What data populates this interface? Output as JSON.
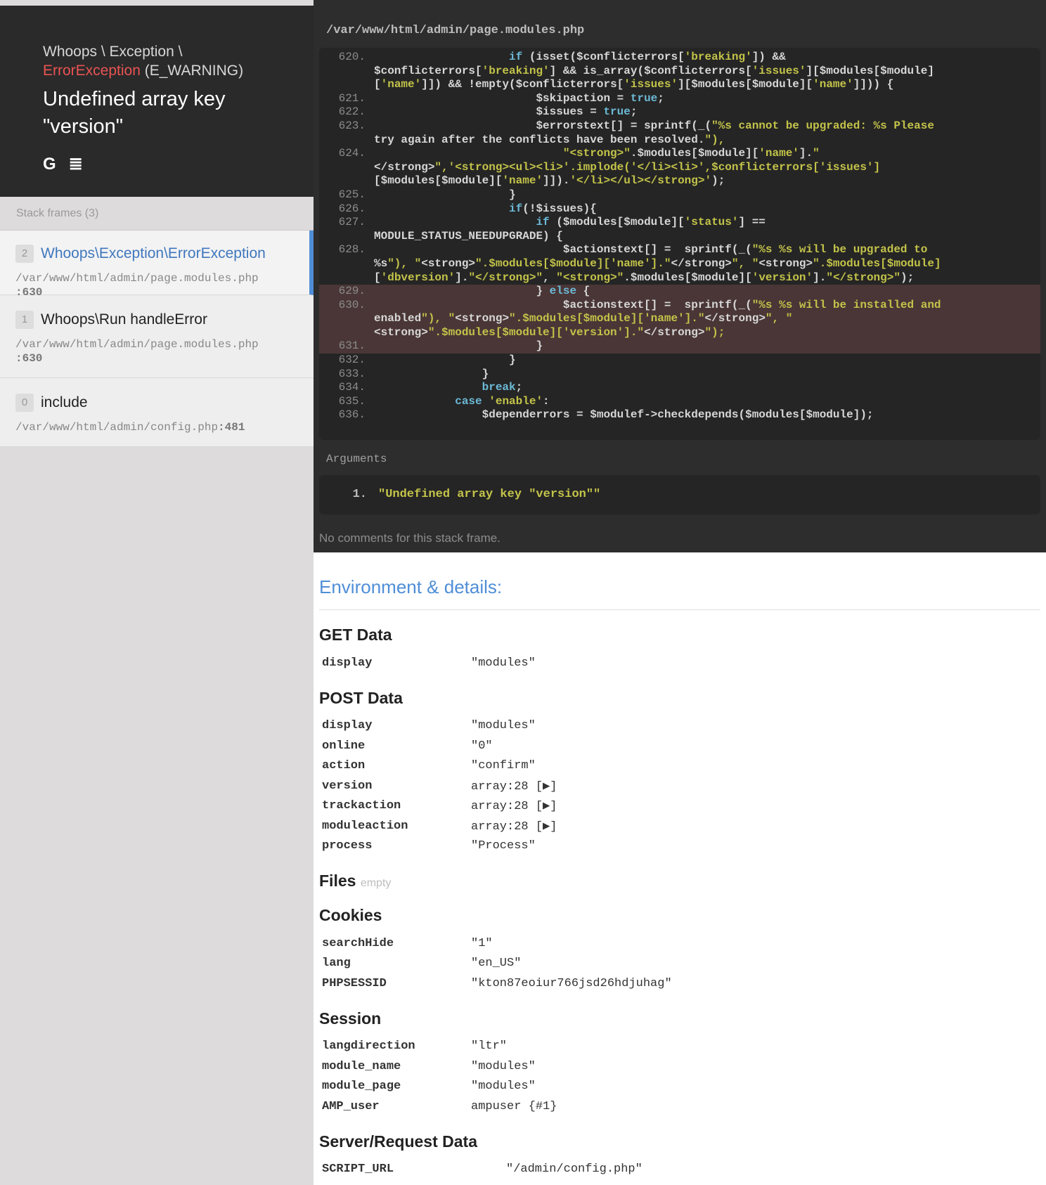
{
  "header": {
    "exception_path": "Whoops \\ Exception \\",
    "exception_class": "ErrorException",
    "exception_type": "(E_WARNING)",
    "message": "Undefined array key \"version\"",
    "icons": [
      "google-icon",
      "stackoverflow-icon"
    ]
  },
  "frames": {
    "title": "Stack frames (3)",
    "items": [
      {
        "index": "2",
        "cls": "Whoops\\Exception\\ErrorException",
        "file": "/var/www/html/admin/page.modules.php",
        "line": ":630"
      },
      {
        "index": "1",
        "cls": "Whoops\\Run handleError",
        "file": "/var/www/html/admin/page.modules.php",
        "line": ":630"
      },
      {
        "index": "0",
        "cls": "include",
        "file": "/var/www/html/admin/config.php",
        "line": ":481"
      }
    ]
  },
  "code": {
    "file_path": "/var/www/html/admin/page.modules.php",
    "lines": [
      {
        "n": "620.",
        "t": "                    if (isset($conflicterrors['breaking']) &&"
      },
      {
        "n": "",
        "t": "$conflicterrors['breaking'] && is_array($conflicterrors['issues'][$modules[$module]"
      },
      {
        "n": "",
        "t": "['name']]) && !empty($conflicterrors['issues'][$modules[$module]['name']])) {"
      },
      {
        "n": "621.",
        "t": "                        $skipaction = true;"
      },
      {
        "n": "622.",
        "t": "                        $issues = true;"
      },
      {
        "n": "623.",
        "t": "                        $errorstext[] = sprintf(_(\"%s cannot be upgraded: %s Please"
      },
      {
        "n": "",
        "t": "try again after the conflicts have been resolved.\"),"
      },
      {
        "n": "624.",
        "t": "                            \"<strong>\".$modules[$module]['name'].\""
      },
      {
        "n": "",
        "t": "</strong>\",'<strong><ul><li>'.implode('</li><li>',$conflicterrors['issues']"
      },
      {
        "n": "",
        "t": "[$modules[$module]['name']]).'</li></ul></strong>');"
      },
      {
        "n": "625.",
        "t": "                    }"
      },
      {
        "n": "626.",
        "t": "                    if(!$issues){"
      },
      {
        "n": "627.",
        "t": "                        if ($modules[$module]['status'] =="
      },
      {
        "n": "",
        "t": "MODULE_STATUS_NEEDUPGRADE) {"
      },
      {
        "n": "628.",
        "t": "                            $actionstext[] =  sprintf(_(\"%s %s will be upgraded to"
      },
      {
        "n": "",
        "t": "%s\"), \"<strong>\".$modules[$module]['name'].\"</strong>\", \"<strong>\".$modules[$module]"
      },
      {
        "n": "",
        "t": "['dbversion'].\"</strong>\", \"<strong>\".$modules[$module]['version'].\"</strong>\");"
      },
      {
        "n": "629.",
        "t": "                        } else {"
      },
      {
        "n": "630.",
        "t": "                            $actionstext[] =  sprintf(_(\"%s %s will be installed and"
      },
      {
        "n": "",
        "t": "enabled\"), \"<strong>\".$modules[$module]['name'].\"</strong>\", \""
      },
      {
        "n": "",
        "t": "<strong>\".$modules[$module]['version'].\"</strong>\");"
      },
      {
        "n": "631.",
        "t": "                        }"
      },
      {
        "n": "632.",
        "t": "                    }"
      },
      {
        "n": "633.",
        "t": "                }"
      },
      {
        "n": "634.",
        "t": "                break;"
      },
      {
        "n": "635.",
        "t": "            case 'enable':"
      },
      {
        "n": "636.",
        "t": "                $dependerrors = $modulef->checkdepends($modules[$module]);"
      }
    ]
  },
  "arguments": {
    "label": "Arguments",
    "items": [
      {
        "n": "1.",
        "v": "\"Undefined array key \"version\"\""
      }
    ]
  },
  "no_comments": "No comments for this stack frame.",
  "env": {
    "title": "Environment & details:",
    "get": {
      "title": "GET Data",
      "rows": [
        [
          "display",
          "\"modules\""
        ]
      ]
    },
    "post": {
      "title": "POST Data",
      "rows": [
        [
          "display",
          "\"modules\""
        ],
        [
          "online",
          "\"0\""
        ],
        [
          "action",
          "\"confirm\""
        ],
        [
          "version",
          "array:28 [▶]"
        ],
        [
          "trackaction",
          "array:28 [▶]"
        ],
        [
          "moduleaction",
          "array:28 [▶]"
        ],
        [
          "process",
          "\"Process\""
        ]
      ]
    },
    "files": {
      "title": "Files",
      "empty": "empty"
    },
    "cookies": {
      "title": "Cookies",
      "rows": [
        [
          "searchHide",
          "\"1\""
        ],
        [
          "lang",
          "\"en_US\""
        ],
        [
          "PHPSESSID",
          "\"kton87eoiur766jsd26hdjuhag\""
        ]
      ]
    },
    "session": {
      "title": "Session",
      "rows": [
        [
          "langdirection",
          "\"ltr\""
        ],
        [
          "module_name",
          "\"modules\""
        ],
        [
          "module_page",
          "\"modules\""
        ],
        [
          "AMP_user",
          "ampuser {#1}"
        ]
      ]
    },
    "server": {
      "title": "Server/Request Data",
      "rows": [
        [
          "SCRIPT_URL",
          "\"/admin/config.php\""
        ]
      ]
    }
  }
}
